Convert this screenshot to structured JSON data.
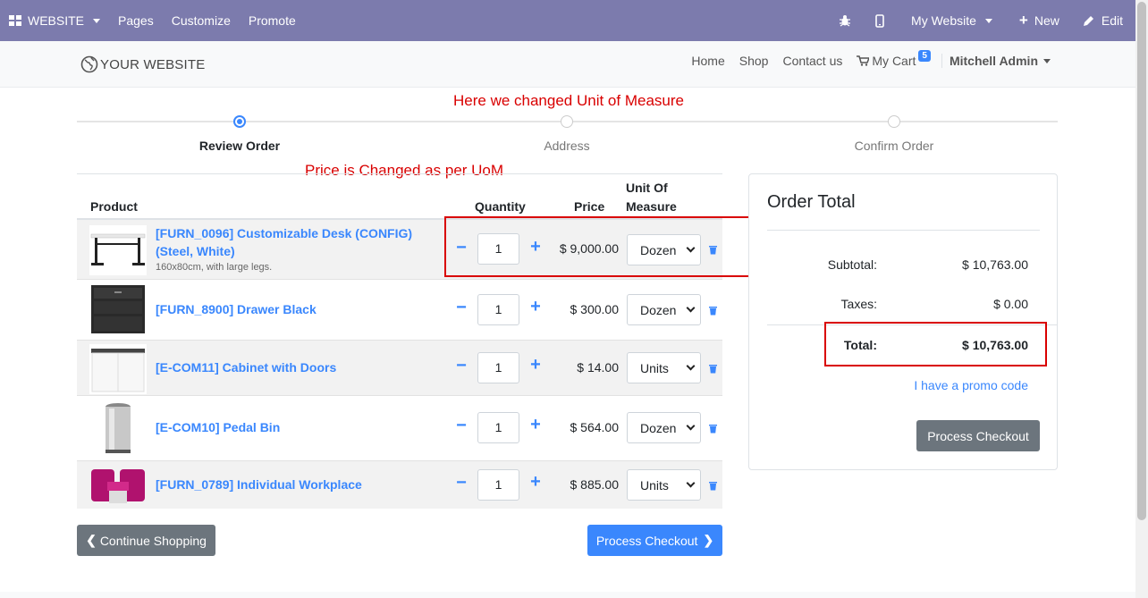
{
  "adminbar": {
    "website_label": "WEBSITE",
    "menu": [
      "Pages",
      "Customize",
      "Promote"
    ],
    "my_website": "My Website",
    "new_label": "New",
    "edit_label": "Edit"
  },
  "header": {
    "logo_text": "YOUR WEBSITE",
    "nav": [
      "Home",
      "Shop",
      "Contact us"
    ],
    "cart_label": "My Cart",
    "cart_count": "5",
    "user": "Mitchell Admin"
  },
  "annotations": {
    "uom_note": "Here we changed Unit of Measure",
    "price_note": "Price is Changed as per UoM"
  },
  "steps": [
    {
      "label": "Review Order",
      "active": true
    },
    {
      "label": "Address",
      "active": false
    },
    {
      "label": "Confirm Order",
      "active": false
    }
  ],
  "table_headers": {
    "product": "Product",
    "quantity": "Quantity",
    "price": "Price",
    "uom_line1": "Unit Of",
    "uom_line2": "Measure"
  },
  "cart_lines": [
    {
      "name": "[FURN_0096] Customizable Desk (CONFIG) (Steel, White)",
      "description": "160x80cm, with large legs.",
      "quantity": "1",
      "price": "$ 9,000.00",
      "uom": "Dozen",
      "thumb": "desk"
    },
    {
      "name": "[FURN_8900] Drawer Black",
      "description": "",
      "quantity": "1",
      "price": "$ 300.00",
      "uom": "Dozen",
      "thumb": "drawer"
    },
    {
      "name": "[E-COM11] Cabinet with Doors",
      "description": "",
      "quantity": "1",
      "price": "$ 14.00",
      "uom": "Units",
      "thumb": "cabinet"
    },
    {
      "name": "[E-COM10] Pedal Bin",
      "description": "",
      "quantity": "1",
      "price": "$ 564.00",
      "uom": "Dozen",
      "thumb": "bin"
    },
    {
      "name": "[FURN_0789] Individual Workplace",
      "description": "",
      "quantity": "1",
      "price": "$ 885.00",
      "uom": "Units",
      "thumb": "workplace"
    }
  ],
  "buttons": {
    "continue_shopping": "Continue Shopping",
    "process_checkout": "Process Checkout"
  },
  "order_total": {
    "title": "Order Total",
    "subtotal_label": "Subtotal:",
    "subtotal_value": "$ 10,763.00",
    "taxes_label": "Taxes:",
    "taxes_value": "$ 0.00",
    "total_label": "Total:",
    "total_value": "$ 10,763.00",
    "promo_link": "I have a promo code",
    "checkout_button": "Process Checkout"
  },
  "colors": {
    "adminbar": "#7c7bad",
    "link": "#3a87fd",
    "annotation": "#d90000",
    "dark_button": "#6c757d"
  }
}
